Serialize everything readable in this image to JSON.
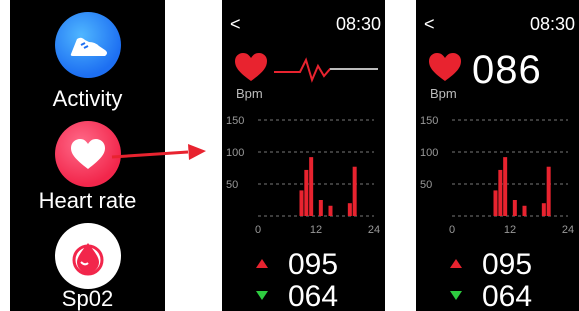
{
  "menu": {
    "items": [
      {
        "label": "Activity",
        "icon": "running-shoe-icon"
      },
      {
        "label": "Heart rate",
        "icon": "heart-icon"
      },
      {
        "label": "Sp02",
        "icon": "blood-drop-icon"
      }
    ]
  },
  "colors": {
    "accent_red": "#e8232f",
    "accent_green": "#2ecc40",
    "activity_blue": "#1d6ff2",
    "heart_pink": "#f2264b"
  },
  "screens": [
    {
      "back_label": "<",
      "time": "08:30",
      "heart_icon": "heart-icon",
      "bpm_label": "Bpm",
      "bpm_value": "",
      "max_value": "095",
      "min_value": "064"
    },
    {
      "back_label": "<",
      "time": "08:30",
      "heart_icon": "heart-icon",
      "bpm_label": "Bpm",
      "bpm_value": "086",
      "max_value": "095",
      "min_value": "064"
    }
  ],
  "chart_data": {
    "type": "bar",
    "y_ticks": [
      "150",
      "100",
      "50"
    ],
    "x_ticks": [
      "0",
      "12",
      "24"
    ],
    "ylim": [
      0,
      150
    ],
    "xlim": [
      0,
      24
    ],
    "bar_color": "#e8232f",
    "grid": true,
    "x": [
      9,
      10,
      11,
      13,
      15,
      19,
      20
    ],
    "values": [
      40,
      72,
      92,
      25,
      16,
      20,
      77
    ]
  }
}
